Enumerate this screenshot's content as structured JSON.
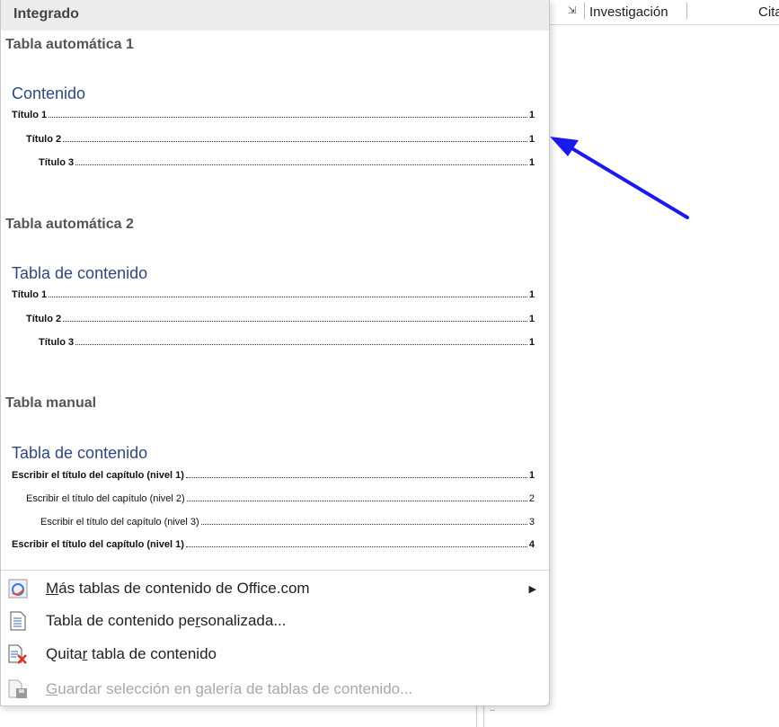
{
  "ribbon": {
    "research": "Investigación",
    "citations": "Cita"
  },
  "header": "Integrado",
  "sections": [
    {
      "title": "Tabla automática 1",
      "toc_title": "Contenido",
      "rows": [
        {
          "text": "Título 1",
          "page": "1"
        },
        {
          "text": "Título 2",
          "page": "1"
        },
        {
          "text": "Título 3",
          "page": "1"
        }
      ]
    },
    {
      "title": "Tabla automática 2",
      "toc_title": "Tabla de contenido",
      "rows": [
        {
          "text": "Título 1",
          "page": "1"
        },
        {
          "text": "Título 2",
          "page": "1"
        },
        {
          "text": "Título 3",
          "page": "1"
        }
      ]
    },
    {
      "title": "Tabla manual",
      "toc_title": "Tabla de contenido",
      "rows": [
        {
          "text": "Escribir el título del capítulo (nivel 1)",
          "page": "1"
        },
        {
          "text": "Escribir el título del capítulo (nivel 2)",
          "page": "2"
        },
        {
          "text": "Escribir el título del capítulo (nivel 3)",
          "page": "3"
        },
        {
          "text": "Escribir el título del capítulo (nivel 1)",
          "page": "4"
        }
      ]
    }
  ],
  "menu": [
    {
      "pre": "",
      "key": "M",
      "post": "ás tablas de contenido de Office.com",
      "icon": "office-globe-icon"
    },
    {
      "pre": "Tabla de contenido pe",
      "key": "r",
      "post": "sonalizada...",
      "icon": "document-list-icon"
    },
    {
      "pre": "Quita",
      "key": "r",
      "post": " tabla de contenido",
      "icon": "remove-toc-icon"
    },
    {
      "pre": "",
      "key": "G",
      "post": "uardar selección en galería de tablas de contenido...",
      "icon": "save-gallery-icon"
    }
  ],
  "colors": {
    "arrow": "#1a1aee",
    "toc_title": "#2e4a7d"
  }
}
